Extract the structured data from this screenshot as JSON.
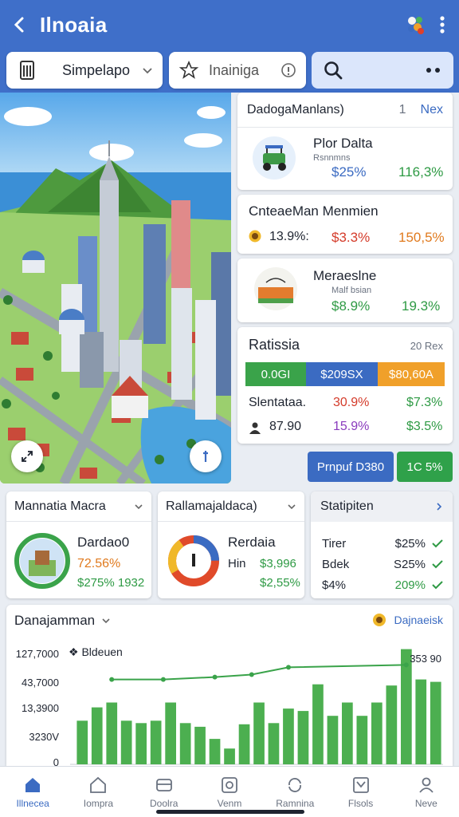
{
  "header": {
    "title": "Ilnoaia"
  },
  "toolbar": {
    "filter_label": "Simpelapo",
    "layer_label": "Inainiga"
  },
  "cards": {
    "c1": {
      "title": "DadogaManlans)",
      "count": "1",
      "link": "Nex",
      "name": "Plor Dalta",
      "sub": "Rsnnmns",
      "v1": "$25%",
      "v2": "116,3%"
    },
    "c2": {
      "title": "CnteaeMan Menmien",
      "v0": "13.9%:",
      "v1": "$3.3%",
      "v2": "150,5%"
    },
    "c3": {
      "title": "Meraeslne",
      "sub": "Malf bsian",
      "v1": "$8.9%",
      "v2": "19.3%"
    },
    "stats": {
      "title": "Ratissia",
      "meta": "20 Rex",
      "segs": [
        "0.0GI",
        "$209SX",
        "$80,60A"
      ],
      "r1": {
        "label": "Slentataa.",
        "a": "30.9%",
        "b": "$7.3%"
      },
      "r2": {
        "label": "87.90",
        "a": "15.9%",
        "b": "$3.5%"
      }
    }
  },
  "buttons": {
    "primary": "Prnpuf D380",
    "secondary": "1C 5%"
  },
  "panels": {
    "p1": {
      "title": "Mannatia Macra",
      "name": "Dardao0",
      "v1": "72.56%",
      "v2": "$275% 1932"
    },
    "p2": {
      "title": "Rallamajaldaca)",
      "name": "Rerdaia",
      "k": "Hin",
      "v1": "$3,996",
      "v2": "$2,55%"
    },
    "p3": {
      "title": "Statipiten",
      "rows": [
        {
          "label": "Tirer",
          "value": "$25%"
        },
        {
          "label": "Bdek",
          "value": "S25%"
        },
        {
          "label": "$4%",
          "value": "209%"
        }
      ]
    }
  },
  "chart": {
    "title": "Danajamman",
    "link": "Dajnaeisk",
    "legend": "Bldeuen",
    "peak_label": "353 90",
    "chart_data": {
      "type": "bar",
      "yticks": [
        "127,7000",
        "43,7000",
        "13,3900",
        "3230V",
        "0"
      ],
      "values": [
        36,
        47,
        51,
        36,
        34,
        36,
        51,
        34,
        31,
        21,
        13,
        33,
        51,
        34,
        46,
        44,
        66,
        40,
        51,
        40,
        51,
        65,
        95,
        70,
        68
      ],
      "line": [
        95,
        null,
        null,
        null,
        null,
        null,
        null,
        null,
        null,
        80,
        null,
        null,
        null,
        null,
        95,
        null,
        null,
        null,
        null,
        null,
        null,
        null,
        95,
        null,
        null
      ]
    }
  },
  "nav": [
    {
      "label": "Illnecea",
      "icon": "home-icon"
    },
    {
      "label": "Iompra",
      "icon": "house-outline-icon"
    },
    {
      "label": "Doolra",
      "icon": "card-icon"
    },
    {
      "label": "Venm",
      "icon": "image-icon"
    },
    {
      "label": "Ramnina",
      "icon": "refresh-icon"
    },
    {
      "label": "Flsols",
      "icon": "check-box-icon"
    },
    {
      "label": "Neve",
      "icon": "user-icon"
    }
  ],
  "colors": {
    "primary": "#3f6fc9",
    "green": "#2e9a44",
    "blue": "#3b6bc2",
    "orange": "#f0a02a"
  }
}
